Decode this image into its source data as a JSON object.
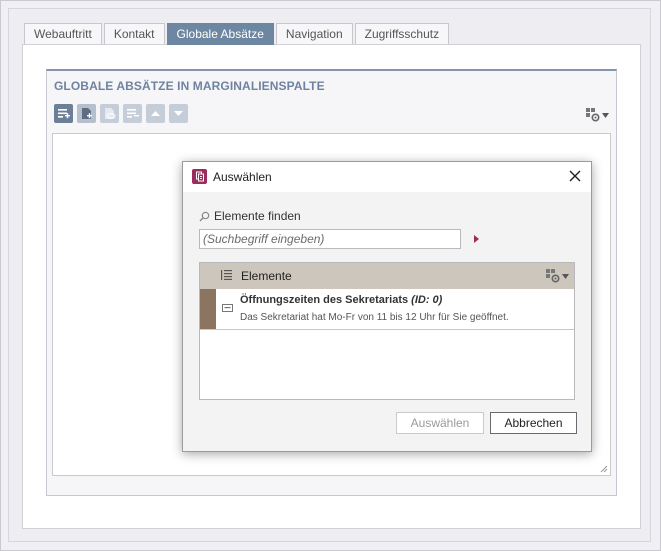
{
  "tabs": [
    {
      "label": "Webauftritt",
      "active": false
    },
    {
      "label": "Kontakt",
      "active": false
    },
    {
      "label": "Globale Absätze",
      "active": true
    },
    {
      "label": "Navigation",
      "active": false
    },
    {
      "label": "Zugriffsschutz",
      "active": false
    }
  ],
  "section": {
    "title": "GLOBALE ABSÄTZE IN MARGINALIENSPALTE",
    "toolbar_icons": [
      "add-section-icon",
      "new-document-icon",
      "preview-icon",
      "remove-icon",
      "move-up-icon",
      "move-down-icon"
    ],
    "settings_icon": "settings-gear-icon"
  },
  "dialog": {
    "title": "Auswählen",
    "find_label": "Elemente finden",
    "search_placeholder": "(Suchbegriff eingeben)",
    "list": {
      "header": "Elemente",
      "items": [
        {
          "title": "Öffnungszeiten des Sekretariats",
          "id_label": "(ID: 0)",
          "description": "Das Sekretariat hat Mo-Fr von 11 bis 12 Uhr für Sie geöffnet."
        }
      ]
    },
    "buttons": {
      "select": "Auswählen",
      "cancel": "Abbrechen"
    }
  },
  "colors": {
    "active_tab": "#6d87a3",
    "section_title": "#6f83a0",
    "dialog_icon": "#9b2c5e",
    "list_header": "#cdc6bd",
    "row_marker": "#8b7560",
    "search_arrow": "#9b2c5e"
  }
}
